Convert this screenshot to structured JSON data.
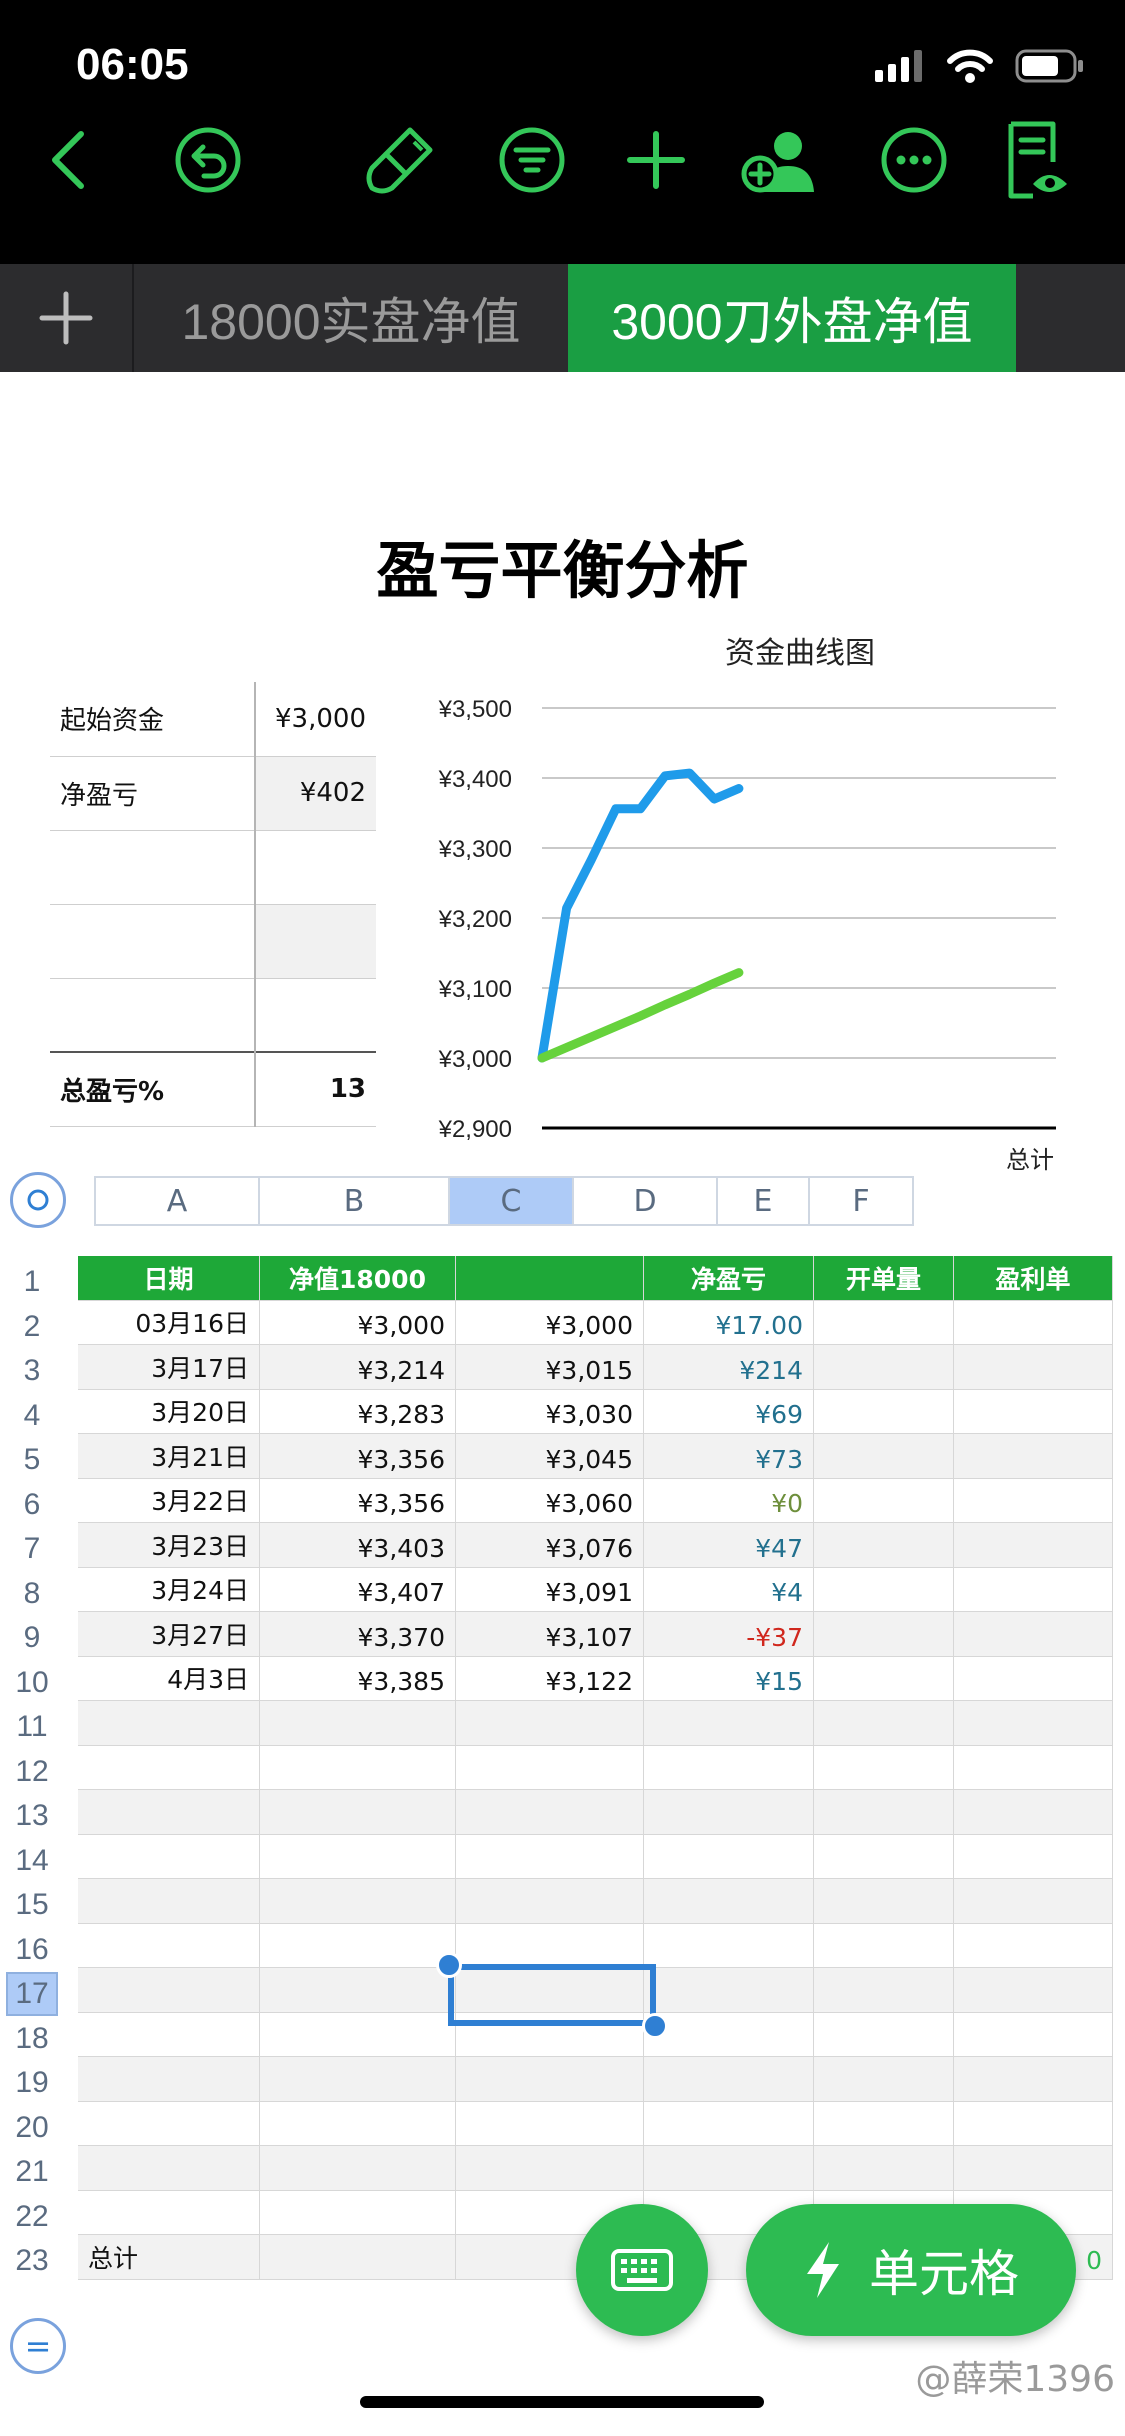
{
  "status": {
    "time": "06:05"
  },
  "tabs": [
    {
      "label": "18000实盘净值"
    },
    {
      "label": "3000刀外盘净值"
    }
  ],
  "title": "盈亏平衡分析",
  "summary": {
    "rows": [
      {
        "label": "起始资金",
        "value": "¥3,000"
      },
      {
        "label": "净盈亏",
        "value": "¥402"
      },
      {
        "label": "",
        "value": ""
      },
      {
        "label": "",
        "value": ""
      },
      {
        "label": "",
        "value": ""
      }
    ],
    "total_label": "总盈亏%",
    "total_value": "13"
  },
  "chart_data": {
    "type": "line",
    "title": "资金曲线图",
    "categories": [
      "03月16日",
      "3月17日",
      "3月20日",
      "3月21日",
      "3月22日",
      "3月23日",
      "3月24日",
      "3月27日",
      "4月3日"
    ],
    "series": [
      {
        "values": [
          3000,
          3214,
          3283,
          3356,
          3356,
          3403,
          3407,
          3370,
          3385
        ],
        "color": "#1f9bea"
      },
      {
        "values": [
          3000,
          3015,
          3030,
          3045,
          3060,
          3076,
          3091,
          3107,
          3122
        ],
        "color": "#66d23c"
      }
    ],
    "ylim": [
      2900,
      3500
    ],
    "yticks": [
      "¥3,500",
      "¥3,400",
      "¥3,300",
      "¥3,200",
      "¥3,100",
      "¥3,000",
      "¥2,900"
    ],
    "xlabel": "总计",
    "grid": true
  },
  "columns": [
    "A",
    "B",
    "C",
    "D",
    "E",
    "F"
  ],
  "selected_column": "C",
  "row_numbers": [
    "1",
    "2",
    "3",
    "4",
    "5",
    "6",
    "7",
    "8",
    "9",
    "10",
    "11",
    "12",
    "13",
    "14",
    "15",
    "16",
    "17",
    "18",
    "19",
    "20",
    "21",
    "22",
    "23"
  ],
  "selected_row": "17",
  "table": {
    "headers": [
      "日期",
      "净值18000",
      "",
      "净盈亏",
      "开单量",
      "盈利单"
    ],
    "rows": [
      {
        "date": "03月16日",
        "nav": "¥3,000",
        "c": "¥3,000",
        "pnl": "¥17.00",
        "pnl_kind": "pos"
      },
      {
        "date": "3月17日",
        "nav": "¥3,214",
        "c": "¥3,015",
        "pnl": "¥214",
        "pnl_kind": "pos"
      },
      {
        "date": "3月20日",
        "nav": "¥3,283",
        "c": "¥3,030",
        "pnl": "¥69",
        "pnl_kind": "pos"
      },
      {
        "date": "3月21日",
        "nav": "¥3,356",
        "c": "¥3,045",
        "pnl": "¥73",
        "pnl_kind": "pos"
      },
      {
        "date": "3月22日",
        "nav": "¥3,356",
        "c": "¥3,060",
        "pnl": "¥0",
        "pnl_kind": "zero"
      },
      {
        "date": "3月23日",
        "nav": "¥3,403",
        "c": "¥3,076",
        "pnl": "¥47",
        "pnl_kind": "pos"
      },
      {
        "date": "3月24日",
        "nav": "¥3,407",
        "c": "¥3,091",
        "pnl": "¥4",
        "pnl_kind": "pos"
      },
      {
        "date": "3月27日",
        "nav": "¥3,370",
        "c": "¥3,107",
        "pnl": "-¥37",
        "pnl_kind": "neg"
      },
      {
        "date": "4月3日",
        "nav": "¥3,385",
        "c": "¥3,122",
        "pnl": "¥15",
        "pnl_kind": "pos"
      }
    ],
    "total_label": "总计",
    "total_value": "0"
  },
  "fab": {
    "cell_label": "单元格"
  },
  "watermark": "@薛荣1396",
  "colors": {
    "accent": "#2dbb52",
    "tab_active": "#1a9e43",
    "header_green": "#1ea838",
    "selection": "#2f7fd3"
  }
}
